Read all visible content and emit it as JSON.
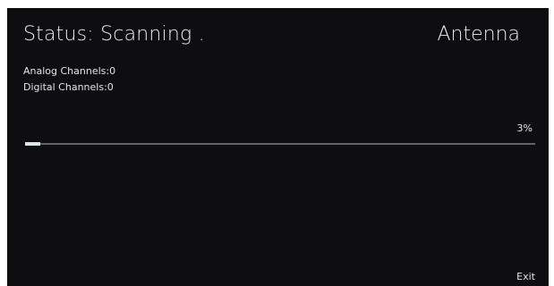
{
  "header": {
    "status": "Status: Scanning .",
    "source": "Antenna"
  },
  "channels": {
    "analog": "Analog Channels:0",
    "digital": "Digital Channels:0"
  },
  "progress": {
    "percent_label": "3%",
    "value": 0.03
  },
  "footer": {
    "exit_label": "Exit"
  },
  "colors": {
    "background": "#0e0e10",
    "text": "#e9e9e9",
    "progress_fill": "#d8e6e8",
    "progress_track": "#5f6466"
  }
}
